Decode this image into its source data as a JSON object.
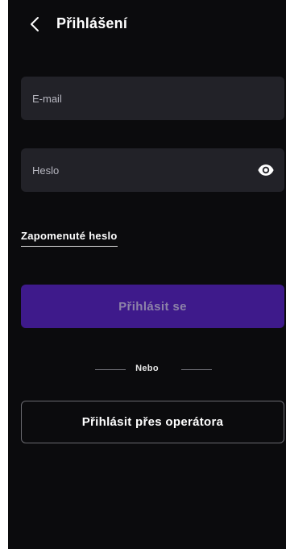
{
  "header": {
    "title": "Přihlášení",
    "back_icon": "chevron-left-icon"
  },
  "form": {
    "email": {
      "placeholder": "E-mail",
      "value": ""
    },
    "password": {
      "placeholder": "Heslo",
      "value": "",
      "toggle_icon": "eye-icon"
    },
    "forgot_password_label": "Zapomenuté heslo",
    "submit_label": "Přihlásit se",
    "divider_label": "Nebo",
    "operator_login_label": "Přihlásit přes operátora"
  },
  "colors": {
    "background": "#0b0b0d",
    "input_background": "#222228",
    "primary_button": "#3e1a8b",
    "primary_button_text": "#8d83a8",
    "text": "#ffffff"
  }
}
